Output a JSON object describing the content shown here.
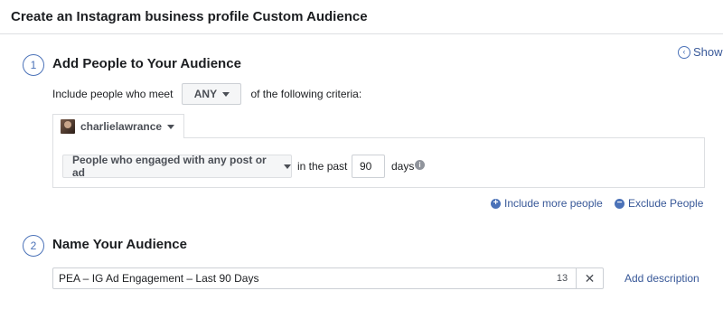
{
  "header": {
    "title": "Create an Instagram business profile Custom Audience"
  },
  "show": {
    "label": "Show",
    "icon": "chevron-left-circle-icon"
  },
  "step1": {
    "number": "1",
    "title": "Add People to Your Audience",
    "criteria_prefix": "Include people who meet",
    "match_value": "ANY",
    "criteria_suffix": "of the following criteria:",
    "account_name": "charlielawrance",
    "rule": {
      "engagement_type": "People who engaged with any post or ad",
      "in_the_past_label": "in the past",
      "days_value": "90",
      "days_label": "days"
    },
    "include_more_label": "Include more people",
    "exclude_label": "Exclude People"
  },
  "step2": {
    "number": "2",
    "title": "Name Your Audience",
    "audience_name": "PEA – IG Ad Engagement – Last 90 Days",
    "remaining_chars": "13",
    "clear_symbol": "✕",
    "add_description_label": "Add description"
  },
  "colors": {
    "accent": "#4b72b8",
    "link": "#385898",
    "border": "#dddfe2",
    "button_bg": "#f5f6f7"
  }
}
